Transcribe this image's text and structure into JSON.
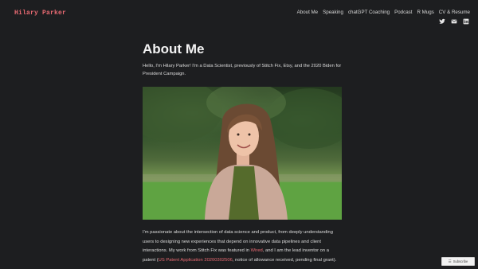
{
  "site": {
    "title": "Hilary Parker"
  },
  "nav": {
    "items": [
      "About Me",
      "Speaking",
      "chatGPT Coaching",
      "Podcast",
      "R Mugs",
      "CV & Resume"
    ]
  },
  "social": [
    "twitter-icon",
    "email-icon",
    "linkedin-icon"
  ],
  "page": {
    "title": "About Me",
    "intro": "Hello, I'm Hilary Parker! I'm a Data Scientist, previously of Stitch Fix, Etsy, and the 2020 Biden for President Campaign.",
    "body_part1": "I'm passionate about the intersection of data science and product, from deeply understanding users to designing new experiences that depend on innovative data pipelines and client interactions. My work from Stitch Fix was featured in ",
    "body_link1": "Wired",
    "body_part2": ", and I am the lead inventor on a patent (",
    "body_link2": "US Patent Application 20200302506",
    "body_part3": ", notice of allowance received, pending final grant)."
  },
  "subscribe": {
    "label": "Subscribe"
  },
  "colors": {
    "background": "#1d1e20",
    "accent": "#e86a72",
    "text": "#dcdcdc"
  }
}
